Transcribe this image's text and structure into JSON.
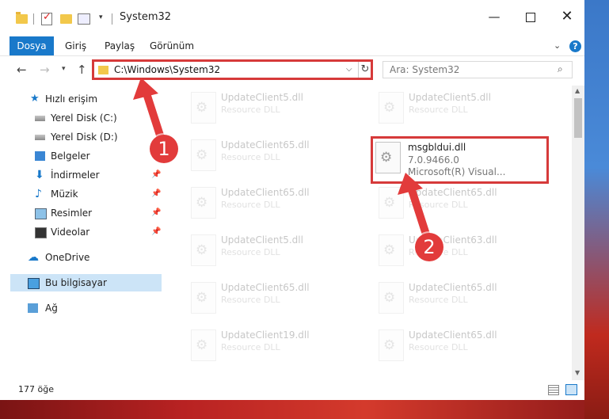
{
  "window": {
    "title": "System32"
  },
  "quick_access": {
    "check_glyph": "✓",
    "dropdown_glyph": "▾"
  },
  "window_controls": {
    "minimize": "—",
    "close": "✕"
  },
  "ribbon": {
    "tabs": [
      "Dosya",
      "Giriş",
      "Paylaş",
      "Görünüm"
    ],
    "collapse_glyph": "⌄",
    "help_glyph": "?"
  },
  "nav": {
    "back": "←",
    "forward": "→",
    "recent": "▾",
    "up": "↑",
    "address": "C:\\Windows\\System32",
    "address_dropdown": "⌵",
    "refresh": "↻",
    "search_placeholder": "Ara: System32",
    "search_glyph": "⌕"
  },
  "sidebar": {
    "items": [
      {
        "label": "Hızlı erişim",
        "icon": "star-icon"
      },
      {
        "label": "Yerel Disk (C:)",
        "icon": "drive-icon"
      },
      {
        "label": "Yerel Disk (D:)",
        "icon": "drive-icon"
      },
      {
        "label": "Belgeler",
        "icon": "documents-icon"
      },
      {
        "label": "İndirmeler",
        "icon": "downloads-icon"
      },
      {
        "label": "Müzik",
        "icon": "music-icon"
      },
      {
        "label": "Resimler",
        "icon": "pictures-icon"
      },
      {
        "label": "Videolar",
        "icon": "videos-icon"
      },
      {
        "label": "OneDrive",
        "icon": "cloud-icon"
      },
      {
        "label": "Bu bilgisayar",
        "icon": "computer-icon"
      },
      {
        "label": "Ağ",
        "icon": "network-icon"
      }
    ],
    "pin_glyph": "📌",
    "star_glyph": "★",
    "down_glyph": "⬇",
    "music_glyph": "♪",
    "cloud_glyph": "☁"
  },
  "files": {
    "left": [
      {
        "name": "UpdateClient5.dll",
        "desc": "Resource DLL"
      },
      {
        "name": "UpdateClient65.dll",
        "desc": "Resource DLL"
      },
      {
        "name": "UpdateClient65.dll",
        "desc": "Resource DLL"
      },
      {
        "name": "UpdateClient5.dll",
        "desc": "Resource DLL"
      },
      {
        "name": "UpdateClient65.dll",
        "desc": "Resource DLL"
      },
      {
        "name": "UpdateClient19.dll",
        "desc": "Resource DLL"
      }
    ],
    "right": [
      {
        "name": "UpdateClient5.dll",
        "desc": "Resource DLL"
      },
      {
        "name": "UpdateClient65.dll",
        "desc": "Resource DLL"
      },
      {
        "name": "UpdateClient63.dll",
        "desc": "Resource DLL"
      },
      {
        "name": "UpdateClient65.dll",
        "desc": "Resource DLL"
      },
      {
        "name": "UpdateClient65.dll",
        "desc": "Resource DLL"
      }
    ],
    "highlighted": {
      "name": "msgbldui.dll",
      "version": "7.0.9466.0",
      "company": "Microsoft(R) Visual..."
    }
  },
  "scrollbar": {
    "up": "▲",
    "down": "▼"
  },
  "status": {
    "item_count": "177 öğe"
  },
  "annotations": {
    "step1": "1",
    "step2": "2",
    "color": "#e23b3b"
  }
}
